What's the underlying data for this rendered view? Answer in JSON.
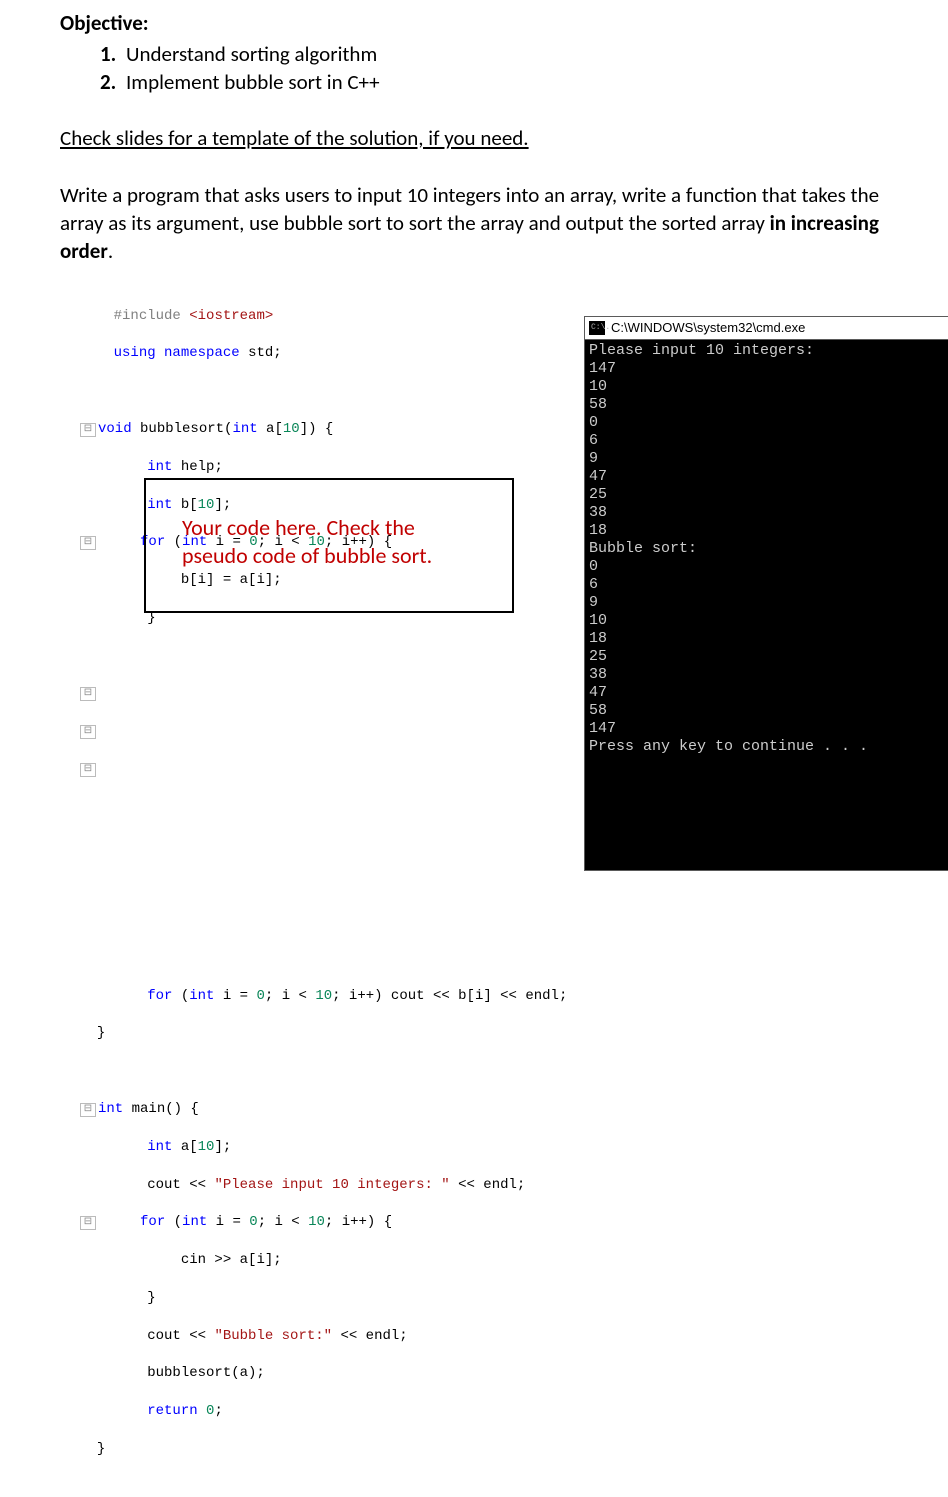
{
  "heading": "Objective:",
  "objectives": [
    {
      "num": "1.",
      "text": "Understand sorting algorithm"
    },
    {
      "num": "2.",
      "text": "Implement bubble sort in C++"
    }
  ],
  "slides_note": "Check slides for a template of the solution, if you need.",
  "body": {
    "part1": "Write a program that asks users to input 10 integers into an array, write a function that takes the array as its argument, use bubble sort to sort the array and output the sorted array ",
    "bold": "in increasing order",
    "part2": "."
  },
  "callout": {
    "l1": "Your code here. Check the",
    "l2": "pseudo code of bubble sort."
  },
  "console": {
    "title": "C:\\WINDOWS\\system32\\cmd.exe",
    "icon": "C:\\.",
    "lines": [
      "Please input 10 integers:",
      "147",
      "10",
      "58",
      "0",
      "6",
      "9",
      "47",
      "25",
      "38",
      "18",
      "Bubble sort:",
      "0",
      "6",
      "9",
      "10",
      "18",
      "25",
      "38",
      "47",
      "58",
      "147",
      "Press any key to continue . . ."
    ]
  },
  "code": {
    "include_kw": "#include ",
    "include_h": "<iostream>",
    "using1": "using",
    "using2": "namespace",
    "using3": "std;",
    "fn_ret": "void",
    "fn_name": " bubblesort(",
    "fn_arg_t": "int",
    "fn_arg": " a[",
    "ten": "10",
    "fn_arg2": "]) {",
    "int_kw": "int",
    "help": " help;",
    "b_decl1": " b[",
    "b_decl2": "];",
    "for_kw": "for",
    "for_head1": " (",
    "for_head2": " i = ",
    "zero": "0",
    "for_head3": "; i < ",
    "for_head4": "; i++) {",
    "copy_line": "b[i] = a[i];",
    "close_brace": "}",
    "out_line1": " (",
    "out_line_full": "; i++) cout << b[i] << endl;",
    "main_ret": "int",
    "main_sig": " main() {",
    "a_decl1": " a[",
    "cout1": "cout << ",
    "str1": "\"Please input 10 integers: \"",
    "endl1": " << endl;",
    "cin_line": "cin >> a[i];",
    "str2": "\"Bubble sort:\"",
    "call": "bubblesort(a);",
    "return_kw": "return",
    "ret_end": ";"
  }
}
